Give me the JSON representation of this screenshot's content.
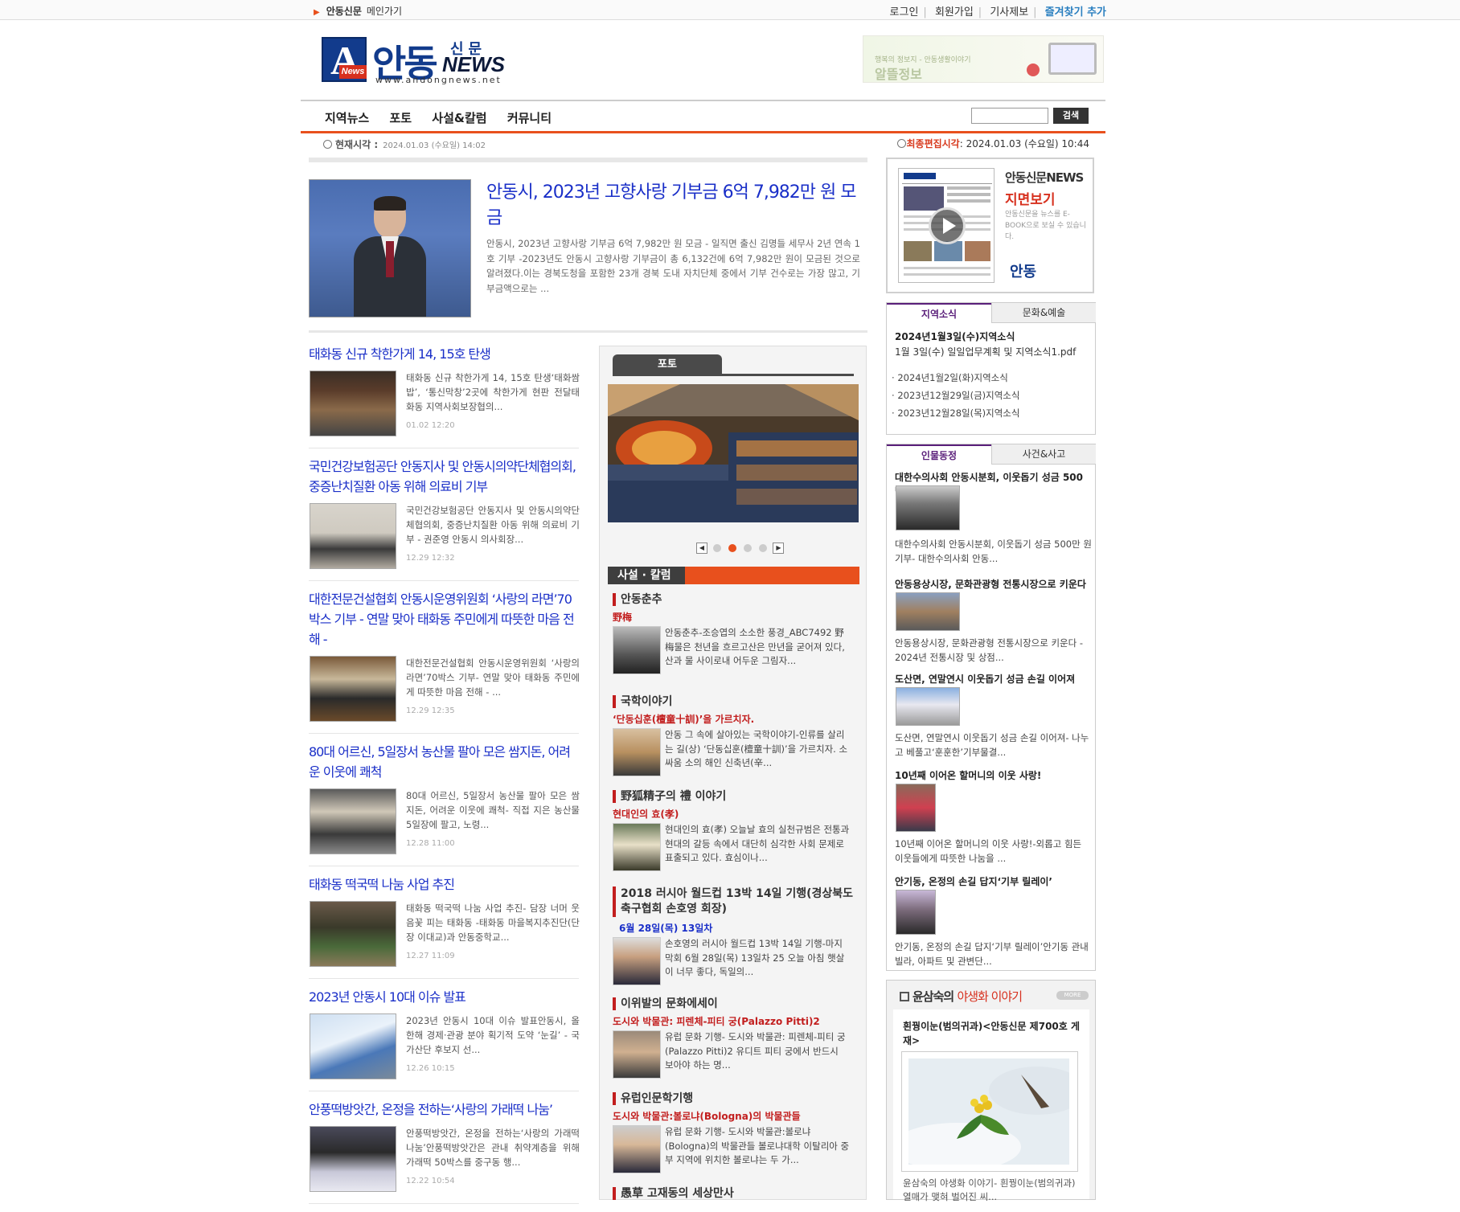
{
  "topbar": {
    "home_site": "안동신문",
    "home_label": "메인가기",
    "links": [
      "로그인",
      "회원가입",
      "기사제보"
    ],
    "favorite": "즐겨찾기 추가"
  },
  "logo": {
    "kor": "안동",
    "sinmun": "신문",
    "news": "NEWS",
    "url": "www.andongnews.net"
  },
  "banner": {
    "line1": "행복의 정보지 - 안동생활이야기",
    "line2": "알뜰정보"
  },
  "nav": {
    "menu": [
      "지역뉴스",
      "포토",
      "사설&칼럼",
      "커뮤니티"
    ],
    "search_button": "검색"
  },
  "timebar": {
    "now_label": "현재시각 :",
    "now_value": "2024.01.03 (수요일) 14:02",
    "edit_label": "최종편집시각",
    "edit_value": ": 2024.01.03 (수요일) 10:44"
  },
  "top_story": {
    "title": "안동시, 2023년 고향사랑 기부금 6억 7,982만 원 모금",
    "summary": "안동시, 2023년 고향사랑 기부금 6억 7,982만 원 모금 - 일직면 출신 김명들 세무사 2년 연속 1호 기부 -2023년도 안동시 고향사랑 기부금이 총 6,132건에 6억 7,982만 원이 모금된 것으로 알려졌다.이는 경북도청을 포함한 23개 경북 도내 자치단체 중에서 기부 건수로는 가장 많고, 기부금액으로는 ..."
  },
  "news": [
    {
      "title": "태화동 신규 착한가게 14, 15호 탄생",
      "summary": "태화동 신규 착한가게 14, 15호 탄생‘태화쌈밥’, ‘통신막창’2곳에 착한가게 현판 전달태화동 지역사회보장협의...",
      "date": "01.02 12:20"
    },
    {
      "title": "국민건강보험공단 안동지사 및 안동시의약단체협의회, 중증난치질환 아동 위해 의료비 기부",
      "summary": "국민건강보험공단 안동지사 및 안동시의약단체협의회, 중증난치질환 아동 위해 의료비 기부 - 권준영 안동시 의사회장...",
      "date": "12.29 12:32"
    },
    {
      "title": "대한전문건설협회 안동시운영위원회 ‘사랑의 라면’70박스 기부 - 연말 맞아 태화동 주민에게 따뜻한 마음 전해 -",
      "summary": "대한전문건설협회 안동시운영위원회 ‘사랑의 라면’70박스 기부- 연말 맞아 태화동 주민에게 따뜻한 마음 전해 - ...",
      "date": "12.29 12:35"
    },
    {
      "title": "80대 어르신, 5일장서 농산물 팔아 모은 쌈지돈, 어려운 이웃에 쾌척",
      "summary": "80대 어르신, 5일장서 농산물 팔아 모은 쌈지돈, 어려운 이웃에 쾌척- 직접 지은 농산물 5일장에 팔고, 노령...",
      "date": "12.28 11:00"
    },
    {
      "title": "태화동 떡국떡 나눔 사업 추진",
      "summary": "태화동 떡국떡 나눔 사업 추진- 담장 너머 웃음꽃 피는 태화동 -태화동 마을복지추진단(단장 이대교)과 안동중학교...",
      "date": "12.27 11:09"
    },
    {
      "title": "2023년 안동시 10대 이슈 발표",
      "summary": "2023년 안동시 10대 이슈 발표안동시, 올 한해 경제·관광 분야 획기적 도약 ‘눈길’ - 국가산단 후보지 선...",
      "date": "12.26 10:15"
    },
    {
      "title": "안풍떡방앗간, 온정을 전하는‘사랑의 가래떡 나눔’",
      "summary": "안풍떡방앗간, 온정을 전하는‘사랑의 가래떡 나눔’안풍떡방앗간은 관내 취약계층을 위해 가래떡 50박스를 중구동 행...",
      "date": "12.22 10:54"
    }
  ],
  "photo": {
    "tab": "포토"
  },
  "column": {
    "header": "사설 · 칼럼",
    "items": [
      {
        "category": "안동춘추",
        "sub": "野梅",
        "desc": "안동춘추-조승엽의 소소한 풍경_ABC7492 野梅물은 천년을 흐르고산은 만년을 굳어져 있다,산과 물 사이로내 어두운 그림자..."
      },
      {
        "category": "국학이야기",
        "sub": "‘단동십훈(檀童十訓)’을 가르치자.",
        "desc": "안동 그 속에 살아있는 국학이야기-인류를 살리는 길(상) ‘단동십훈(檀童十訓)’을 가르치자. 소싸움 소의 해인 신축년(辛..."
      },
      {
        "category": "野狐精子의 禮 이야기",
        "sub": "현대인의 효(孝)",
        "desc": "현대인의 효(孝) 오늘날 효의 실천규범은 전통과 현대의 갈등 속에서 대단히 심각한 사회 문제로 표출되고 있다. 효심이나..."
      },
      {
        "category": "2018 러시아 월드컵 13박 14일 기행(경상북도축구협회 손호영 회장)",
        "sub": "6월 28일(목) 13일차",
        "desc": "손호영의 러시아 월드컵 13박 14일 기행-마지막회 6월 28일(목) 13일차 25 오늘 아침 햇살이 너무 좋다, 독일의..."
      },
      {
        "category": "이위발의 문화에세이",
        "sub": "도시와 박물관: 피렌체-피티 궁(Palazzo Pitti)2",
        "desc": "유럽 문화 기행- 도시와 박물관: 피렌체-피티 궁(Palazzo Pitti)2 유디트 피티 궁에서 반드시 보아야 하는 명..."
      },
      {
        "category": "유럽인문학기행",
        "sub": "도시와 박물관:볼로냐(Bologna)의 박물관들",
        "desc": "유럽 문화 기행- 도시와 박물관:볼로냐(Bologna)의 박물관들 볼로냐대학 이탈리아 중부 지역에 위치한 볼로냐는 두 가..."
      },
      {
        "category": "愚草 고재동의 세상만사",
        "sub": "",
        "desc": ""
      }
    ]
  },
  "ebook": {
    "title": "안동신문NEWS",
    "subtitle": "지면보기",
    "desc": "안동신문을 뉴스를 E-BOOK으로 보실 수 있습니다.",
    "mini_logo": "안동"
  },
  "local_news": {
    "tabs": [
      "지역소식",
      "문화&예술"
    ],
    "headline": "2024년1월3일(수)지역소식",
    "headline_sub": "1월 3일(수) 일일업무계획 및 지역소식1.pdf",
    "items": [
      "2024년1월2일(화)지역소식",
      "2023년12월29일(금)지역소식",
      "2023년12월28일(목)지역소식"
    ]
  },
  "people_news": {
    "tabs": [
      "인물동정",
      "사건&사고"
    ],
    "items": [
      {
        "title": "대한수의사회 안동시분회, 이웃돕기 성금 500만 원 기부",
        "desc": "대한수의사회 안동시분회, 이웃돕기 성금 500만 원 기부- 대한수의사회 안동..."
      },
      {
        "title": "안동용상시장, 문화관광형 전통시장으로 키운다",
        "desc": "안동용상시장, 문화관광형 전통시장으로 키운다 - 2024년 전통시장 및 상점..."
      },
      {
        "title": "도산면, 연말연시 이웃돕기 성금 손길 이어져",
        "desc": "도산면, 연말연시 이웃돕기 성금 손길 이어져- 나누고 베풀고‘훈훈한’기부물결..."
      },
      {
        "title": "10년째 이어온 할머니의 이웃 사랑!",
        "desc": "10년째 이어온 할머니의 이웃 사랑!-외롭고 힘든 이웃들에게 따뜻한 나눔을 ..."
      },
      {
        "title": "안기동, 온정의 손길 답지‘기부 릴레이’",
        "desc": "안기동, 온정의 손길 답지‘기부 릴레이’안기동 관내 빌라, 아파트 및 관변단..."
      }
    ]
  },
  "wildflower": {
    "header_name": "윤삼숙의",
    "header_topic": "야생화 이야기",
    "more": "MORE",
    "title": "흰꿩이눈(범의귀과)<안동신문 제700호 게재>",
    "desc": "윤삼숙의 야생화 이야기- 흰꿩이눈(범의귀과) 열매가 맺혀 벌어진 씨..."
  }
}
